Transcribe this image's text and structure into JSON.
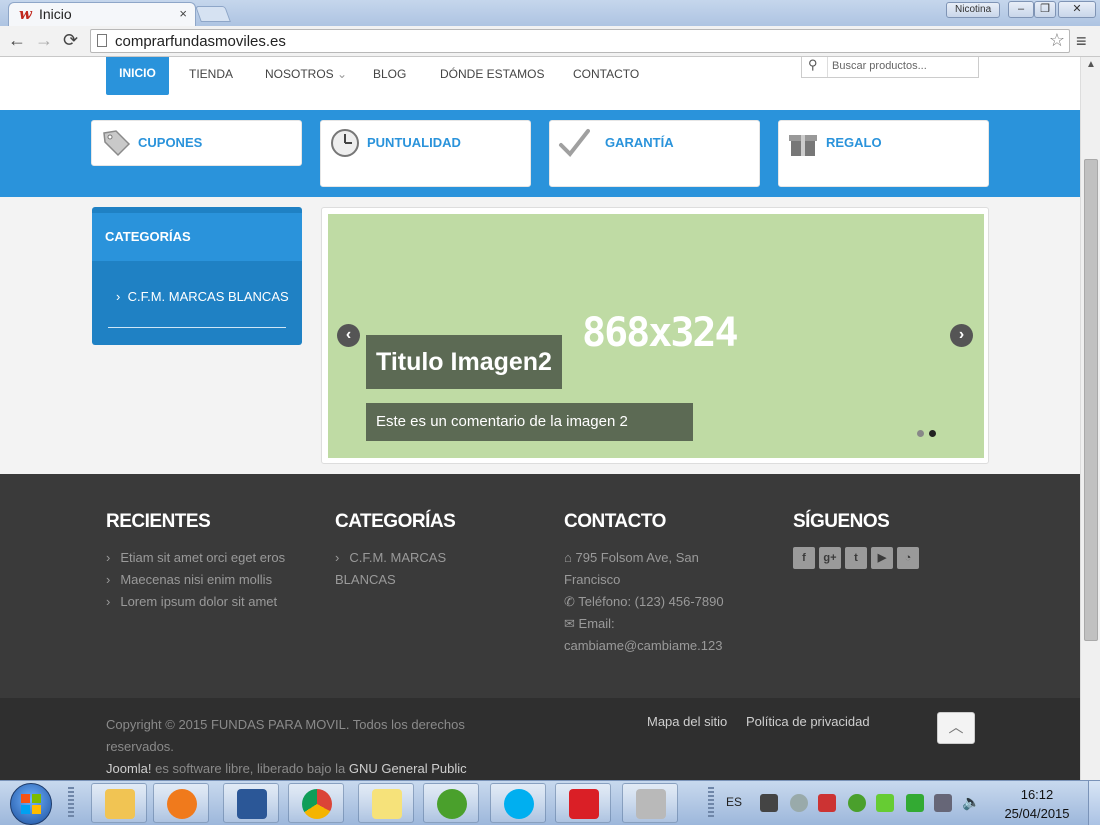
{
  "browser": {
    "tab_title": "Inicio",
    "tab_close": "×",
    "favicon": "w",
    "profile_name": "Nicotina",
    "url": "comprarfundasmoviles.es"
  },
  "nav": {
    "items": [
      "INICIO",
      "TIENDA",
      "NOSOTROS",
      "BLOG",
      "DÓNDE ESTAMOS",
      "CONTACTO"
    ],
    "search_placeholder": "Buscar productos..."
  },
  "features": [
    {
      "label": "CUPONES",
      "icon": "tag-icon"
    },
    {
      "label": "PUNTUALIDAD",
      "icon": "clock-icon"
    },
    {
      "label": "GARANTÍA",
      "icon": "checkmark-icon"
    },
    {
      "label": "REGALO",
      "icon": "gift-icon"
    }
  ],
  "sidebar": {
    "title": "CATEGORÍAS",
    "items": [
      "C.F.M. MARCAS BLANCAS"
    ]
  },
  "slider": {
    "placeholder_size": "868x324",
    "title": "Titulo Imagen2",
    "caption": "Este es un comentario de la imagen 2",
    "prev": "‹",
    "next": "›",
    "slide_count": 2,
    "active_slide": 2
  },
  "footer": {
    "recent": {
      "title": "RECIENTES",
      "items": [
        "Etiam sit amet orci eget eros",
        "Maecenas nisi enim mollis",
        "Lorem ipsum dolor sit amet"
      ]
    },
    "categories": {
      "title": "CATEGORÍAS",
      "items": [
        "C.F.M. MARCAS BLANCAS"
      ]
    },
    "contact": {
      "title": "CONTACTO",
      "address": "795 Folsom Ave, San Francisco",
      "phone": "Teléfono: (123) 456-7890",
      "email_label": "Email:",
      "email": "cambiame@cambiame.123"
    },
    "follow": {
      "title": "SÍGUENOS",
      "networks": [
        "facebook-icon",
        "google-plus-icon",
        "twitter-icon",
        "youtube-icon",
        "rss-icon"
      ]
    }
  },
  "bottom": {
    "copyright": "Copyright © 2015 FUNDAS PARA MOVIL. Todos los derechos reservados.",
    "joomla": "Joomla!",
    "joomla_text": "es software libre, liberado bajo la",
    "license": "GNU General Public",
    "sitemap": "Mapa del sitio",
    "privacy": "Política de privacidad"
  },
  "taskbar": {
    "lang": "ES",
    "time": "16:12",
    "date": "25/04/2015"
  },
  "colors": {
    "brand_blue": "#2a93db",
    "footer_bg": "#3a3a3a",
    "slide_bg": "#bfdba4"
  }
}
